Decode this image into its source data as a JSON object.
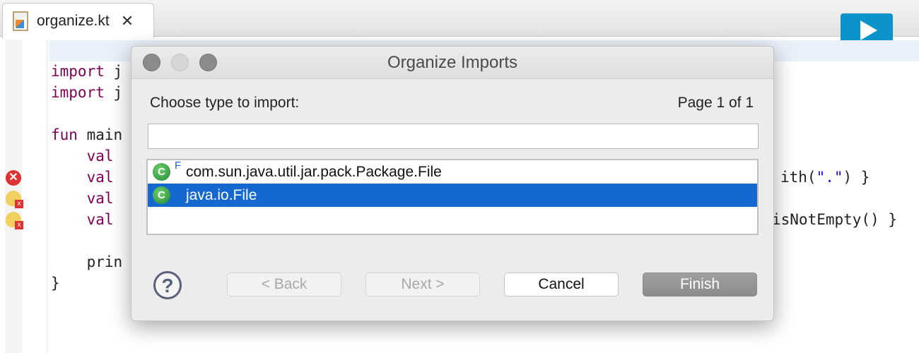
{
  "editor": {
    "tab": {
      "label": "organize.kt",
      "close_icon": "close-x-icon"
    },
    "run_icon": "play-icon",
    "lines": [
      {
        "kw": "import",
        "rest": " j"
      },
      {
        "kw": "import",
        "rest": " j"
      },
      {
        "kw": "fun",
        "rest": " main"
      },
      {
        "kw": "    val",
        "rest": " "
      },
      {
        "kw": "    val",
        "rest": " "
      },
      {
        "kw": "    val",
        "rest": " "
      },
      {
        "kw": "    val",
        "rest": " "
      },
      {
        "kw": "",
        "rest": "    prin"
      },
      {
        "kw": "",
        "rest": "}"
      }
    ],
    "right_fragments": {
      "line5_a": "ith(",
      "line5_str": "\".\"",
      "line5_b": ") }",
      "line7": "isNotEmpty() }"
    }
  },
  "dialog": {
    "title": "Organize Imports",
    "prompt": "Choose type to import:",
    "page": "Page 1 of 1",
    "filter_value": "",
    "items": [
      {
        "label": "com.sun.java.util.jar.pack.Package.File",
        "icon": "class-icon",
        "badge": "F",
        "selected": false
      },
      {
        "label": "java.io.File",
        "icon": "class-icon",
        "selected": true
      }
    ],
    "buttons": {
      "back": "< Back",
      "next": "Next >",
      "cancel": "Cancel",
      "finish": "Finish"
    },
    "help_icon": "help-icon"
  },
  "colors": {
    "keyword": "#7f0055",
    "string": "#2a00ff",
    "selection": "#1468d0",
    "run_button": "#0b94cb"
  }
}
